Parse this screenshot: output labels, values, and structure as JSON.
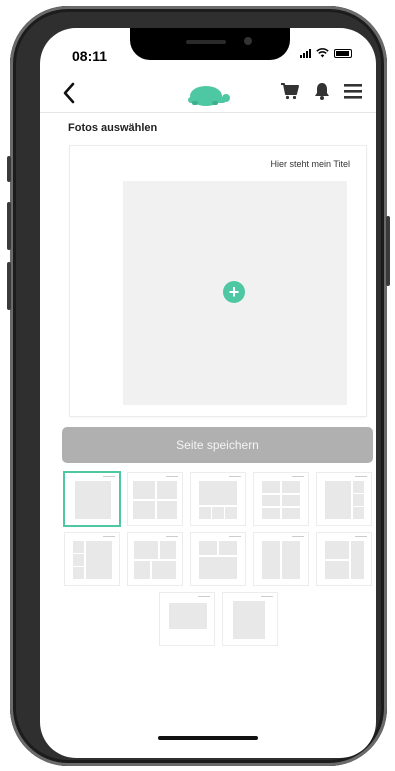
{
  "status_bar": {
    "time": "08:11"
  },
  "header": {
    "back_icon": "chevron-left-icon",
    "logo_icon": "turtle-logo-icon",
    "cart_icon": "cart-icon",
    "bell_icon": "bell-icon",
    "menu_icon": "hamburger-menu-icon"
  },
  "section": {
    "title": "Fotos auswählen"
  },
  "page_preview": {
    "title": "Hier steht mein Titel",
    "add_photo_label": "+"
  },
  "actions": {
    "save_label": "Seite speichern"
  },
  "colors": {
    "accent": "#4ec7a3",
    "button_disabled": "#b0b0b0",
    "slot": "#f1f1f1"
  },
  "layouts": [
    {
      "name": "layout-single",
      "selected": true
    },
    {
      "name": "layout-four-grid",
      "selected": false
    },
    {
      "name": "layout-large-top-three-bottom",
      "selected": false
    },
    {
      "name": "layout-six-grid",
      "selected": false
    },
    {
      "name": "layout-large-left-three-right",
      "selected": false
    },
    {
      "name": "layout-large-right-three-left",
      "selected": false
    },
    {
      "name": "layout-two-top-two-bottom",
      "selected": false
    },
    {
      "name": "layout-large-bottom-two-top",
      "selected": false
    },
    {
      "name": "layout-two-columns",
      "selected": false
    },
    {
      "name": "layout-large-top-two-right",
      "selected": false
    },
    {
      "name": "layout-landscape",
      "selected": false
    },
    {
      "name": "layout-portrait",
      "selected": false
    }
  ]
}
